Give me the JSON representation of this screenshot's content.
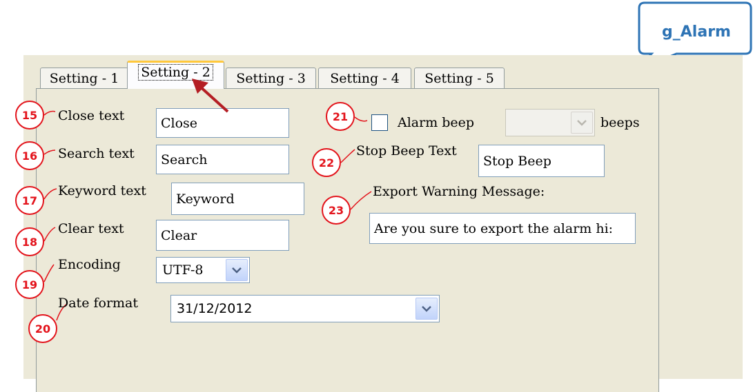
{
  "callout": {
    "label": "g_Alarm"
  },
  "tabs": [
    {
      "label": "Setting - 1"
    },
    {
      "label": "Setting - 2"
    },
    {
      "label": "Setting - 3"
    },
    {
      "label": "Setting - 4"
    },
    {
      "label": "Setting - 5"
    }
  ],
  "active_tab": "Setting - 2",
  "badges": [
    "15",
    "16",
    "17",
    "18",
    "19",
    "20",
    "21",
    "22",
    "23"
  ],
  "fields": {
    "close": {
      "label": "Close text",
      "value": "Close"
    },
    "search": {
      "label": "Search text",
      "value": "Search"
    },
    "keyword": {
      "label": "Keyword text",
      "value": "Keyword"
    },
    "clear": {
      "label": "Clear text",
      "value": "Clear"
    },
    "encoding": {
      "label": "Encoding",
      "value": "UTF-8"
    },
    "date_format": {
      "label": "Date format",
      "value": "31/12/2012"
    },
    "alarm_beep": {
      "label": "Alarm beep",
      "checked": false,
      "value": "",
      "suffix": "beeps"
    },
    "stop_beep": {
      "label": "Stop Beep Text",
      "value": "Stop Beep"
    },
    "export_warning": {
      "label": "Export Warning Message:",
      "value": "Are you sure to export the alarm hi:"
    }
  },
  "colors": {
    "annotation": "#E3131B",
    "callout": "#2E74B5",
    "panel": "#ECE9D8"
  }
}
